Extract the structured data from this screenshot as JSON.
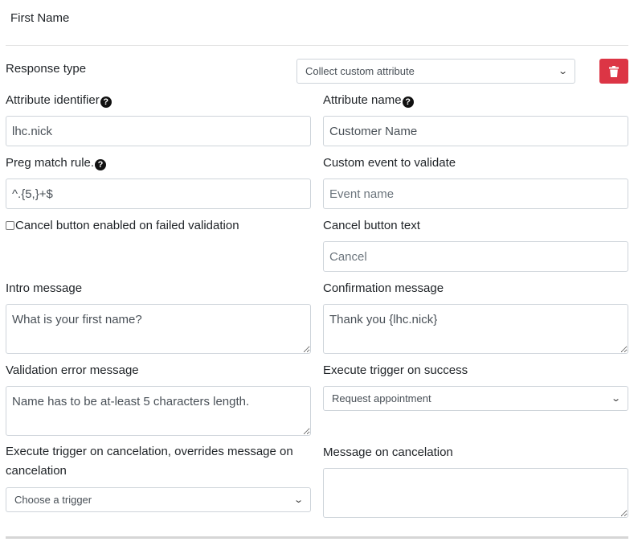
{
  "header": {
    "title": "First Name"
  },
  "response_type": {
    "label": "Response type",
    "selected": "Collect custom attribute"
  },
  "attribute_identifier": {
    "label": "Attribute identifier",
    "value": "lhc.nick"
  },
  "attribute_name": {
    "label": "Attribute name",
    "value": "Customer Name"
  },
  "preg_match": {
    "label": "Preg match rule.",
    "value": "^.{5,}+$"
  },
  "custom_event": {
    "label": "Custom event to validate",
    "placeholder": "Event name"
  },
  "cancel_enabled": {
    "label": "Cancel button enabled on failed validation",
    "checked": false
  },
  "cancel_text": {
    "label": "Cancel button text",
    "placeholder": "Cancel"
  },
  "intro_message": {
    "label": "Intro message",
    "value": "What is your first name?"
  },
  "confirmation_message": {
    "label": "Confirmation message",
    "value": "Thank you {lhc.nick}"
  },
  "validation_error": {
    "label": "Validation error message",
    "value": "Name has to be at-least 5 characters length."
  },
  "trigger_success": {
    "label": "Execute trigger on success",
    "selected": "Request appointment"
  },
  "trigger_cancel": {
    "label": "Execute trigger on cancelation, overrides message on cancelation",
    "selected": "Choose a trigger"
  },
  "message_cancel": {
    "label": "Message on cancelation",
    "value": ""
  },
  "icons": {
    "help": "question-circle-icon",
    "delete": "trash-icon",
    "dropdown": "chevron-down-icon"
  },
  "colors": {
    "danger": "#dc3545",
    "border": "#ced4da"
  }
}
